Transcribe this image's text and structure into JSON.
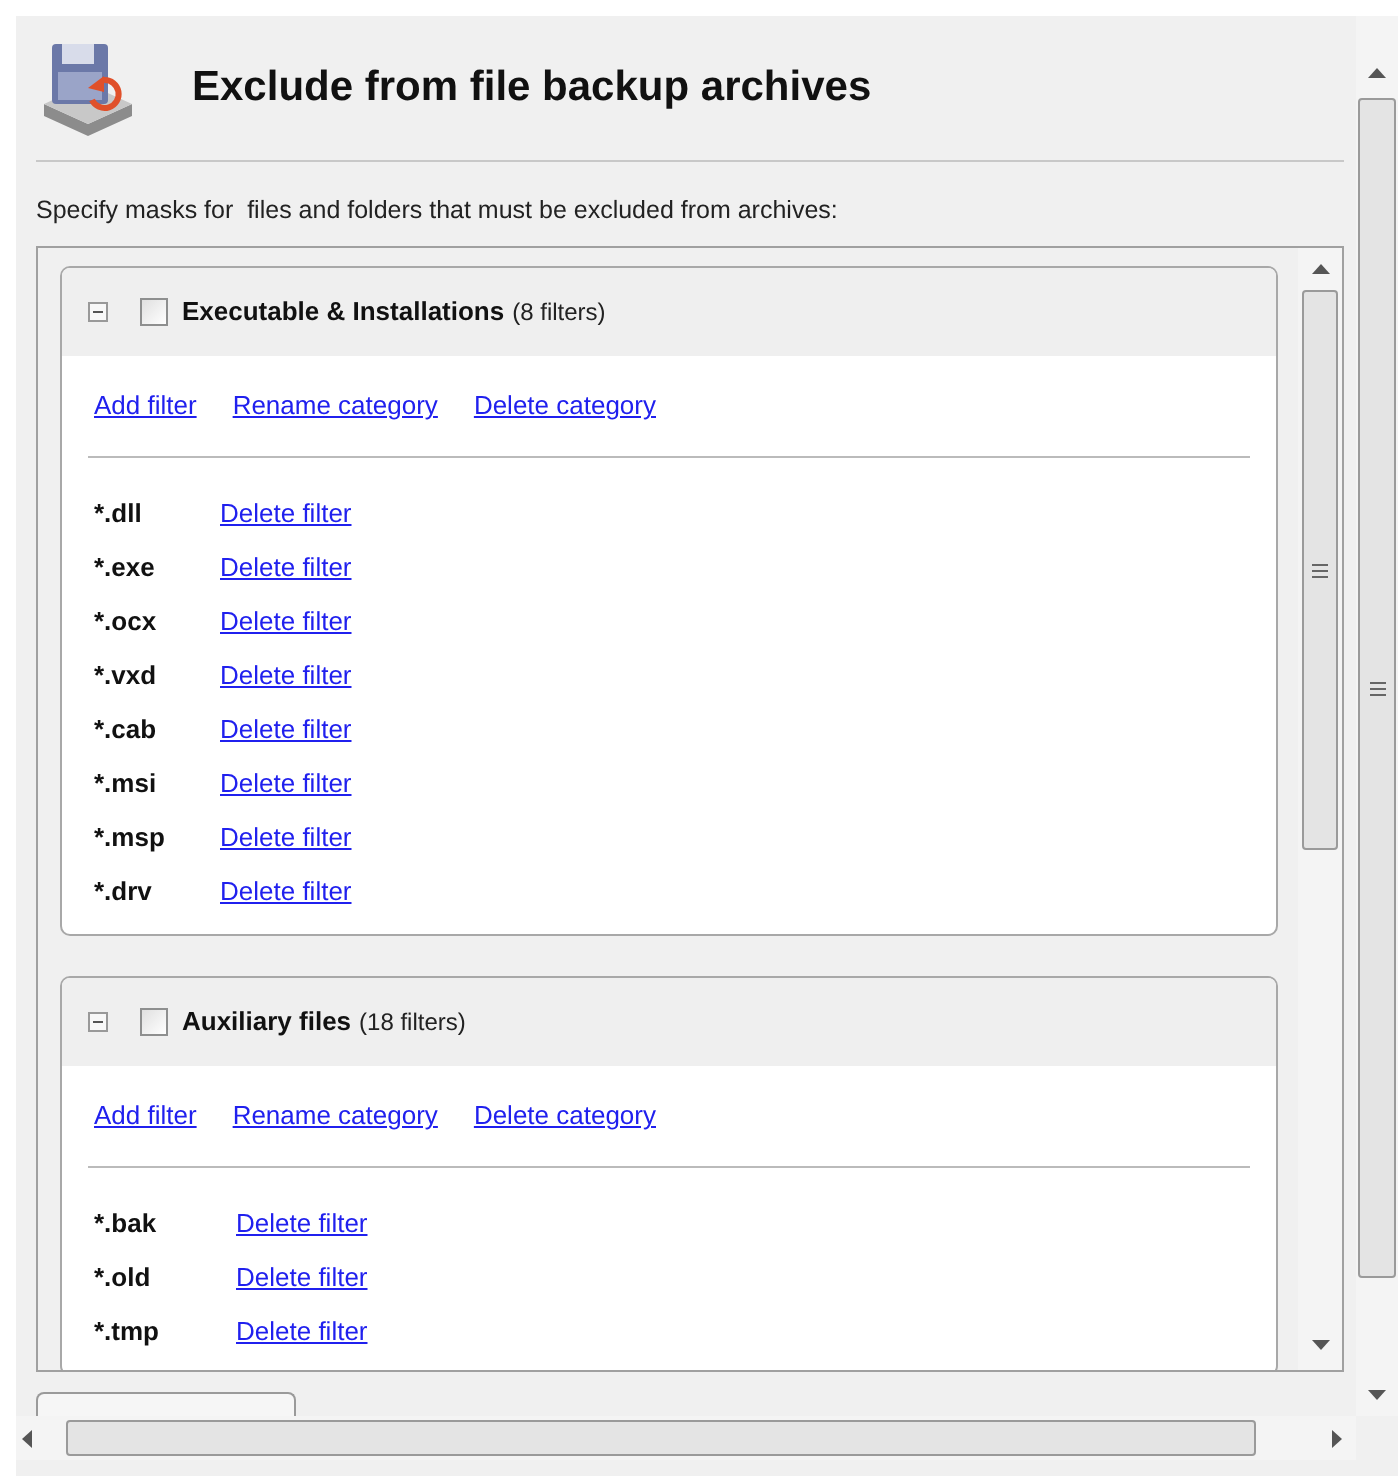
{
  "header": {
    "title": "Exclude from file backup archives",
    "instruction": "Specify masks for  files and folders that must be excluded from archives:"
  },
  "categories": [
    {
      "name": "Executable & Installations",
      "count": "(8 filters)",
      "expanded": true,
      "checked": false,
      "actions": [
        "Add filter",
        "Rename category",
        "Delete category"
      ],
      "filters": [
        {
          "mask": "*.dll",
          "action": "Delete filter"
        },
        {
          "mask": "*.exe",
          "action": "Delete filter"
        },
        {
          "mask": "*.ocx",
          "action": "Delete filter"
        },
        {
          "mask": "*.vxd",
          "action": "Delete filter"
        },
        {
          "mask": "*.cab",
          "action": "Delete filter"
        },
        {
          "mask": "*.msi",
          "action": "Delete filter"
        },
        {
          "mask": "*.msp",
          "action": "Delete filter"
        },
        {
          "mask": "*.drv",
          "action": "Delete filter"
        }
      ]
    },
    {
      "name": "Auxiliary files",
      "count": "(18 filters)",
      "expanded": true,
      "checked": false,
      "actions": [
        "Add filter",
        "Rename category",
        "Delete category"
      ],
      "filters": [
        {
          "mask": "*.bak",
          "action": "Delete filter"
        },
        {
          "mask": "*.old",
          "action": "Delete filter"
        },
        {
          "mask": "*.tmp",
          "action": "Delete filter"
        }
      ]
    }
  ]
}
